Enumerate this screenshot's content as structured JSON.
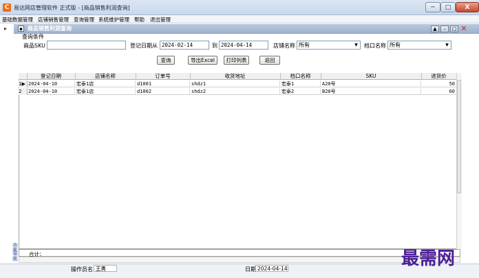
{
  "window": {
    "title": "易达网店管理软件 正式版  - [商品销售利润查询]",
    "icon_letter": "C",
    "controls": {
      "minimize": "─",
      "maximize": "□",
      "close": "X"
    }
  },
  "menu": [
    "基础数据管理",
    "店铺销售管理",
    "查询管理",
    "系统维护管理",
    "帮助",
    "退出管理"
  ],
  "mdi": {
    "arrow": "▸",
    "title": "商品销售利润查询",
    "controls": [
      "▲",
      "–",
      "□"
    ],
    "close": "✕"
  },
  "filters": {
    "section_title": "查询条件",
    "sku_label": "商品SKU",
    "sku_value": "",
    "date_label": "登记日期从",
    "date_from": "2024-02-14",
    "date_to_label": "到",
    "date_to": "2024-04-14",
    "shop_label": "店铺名称",
    "shop_value": "所有",
    "port_label": "档口名称",
    "port_value": "所有",
    "dropdown_glyph": "▼"
  },
  "buttons": {
    "query": "查询",
    "export": "导出Excel",
    "print": "打印列表",
    "back": "返回"
  },
  "grid": {
    "columns": [
      "登记日期",
      "店铺名称",
      "订单号",
      "收货地址",
      "档口名称",
      "SKU",
      "进货价"
    ],
    "rows": [
      {
        "num": "1",
        "indicator": "▶",
        "cells": [
          "2024-04-10",
          "宏泰1店",
          "d1001",
          "shdz1",
          "宏泰1",
          "A20号",
          "50"
        ]
      },
      {
        "num": "2",
        "indicator": "",
        "cells": [
          "2024-04-10",
          "宏泰1店",
          "d1002",
          "shdz2",
          "宏泰2",
          "B20号",
          "60"
        ]
      }
    ],
    "total_label": "合计："
  },
  "status": {
    "operator_label": "操作员名",
    "operator_value": "王勇",
    "date_label": "日期",
    "date_value": "2024-04-14"
  },
  "sidetab": "功能导航",
  "watermark": "最需网"
}
